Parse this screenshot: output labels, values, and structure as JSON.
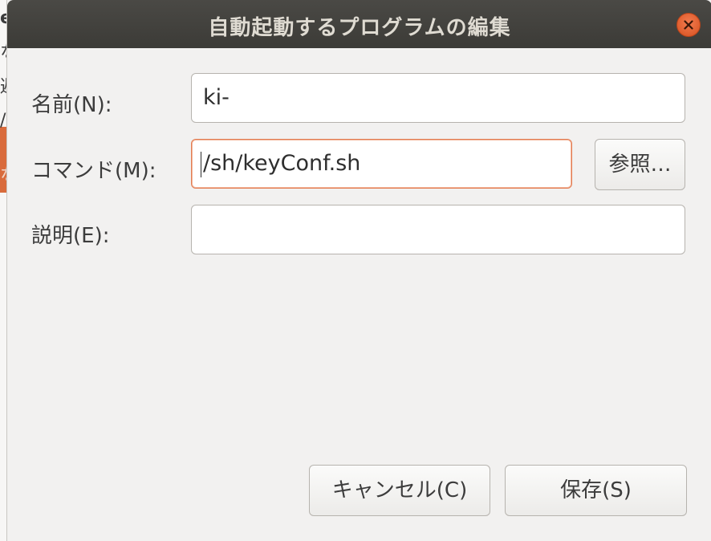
{
  "dialog": {
    "title": "自動起動するプログラムの編集",
    "close_icon": "close-icon"
  },
  "form": {
    "name_label": "名前(N):",
    "name_value": "ki-",
    "command_label": "コマンド(M):",
    "command_value": "/sh/keyConf.sh",
    "browse_label": "参照…",
    "comment_label": "説明(E):",
    "comment_value": ""
  },
  "buttons": {
    "cancel_label": "キャンセル(C)",
    "save_label": "保存(S)"
  },
  "background": {
    "fragments": [
      "e",
      "な",
      "避",
      "/",
      "な"
    ]
  },
  "colors": {
    "titlebar": "#3c3b37",
    "close_button": "#e95420",
    "focus_border": "#e27c52"
  }
}
